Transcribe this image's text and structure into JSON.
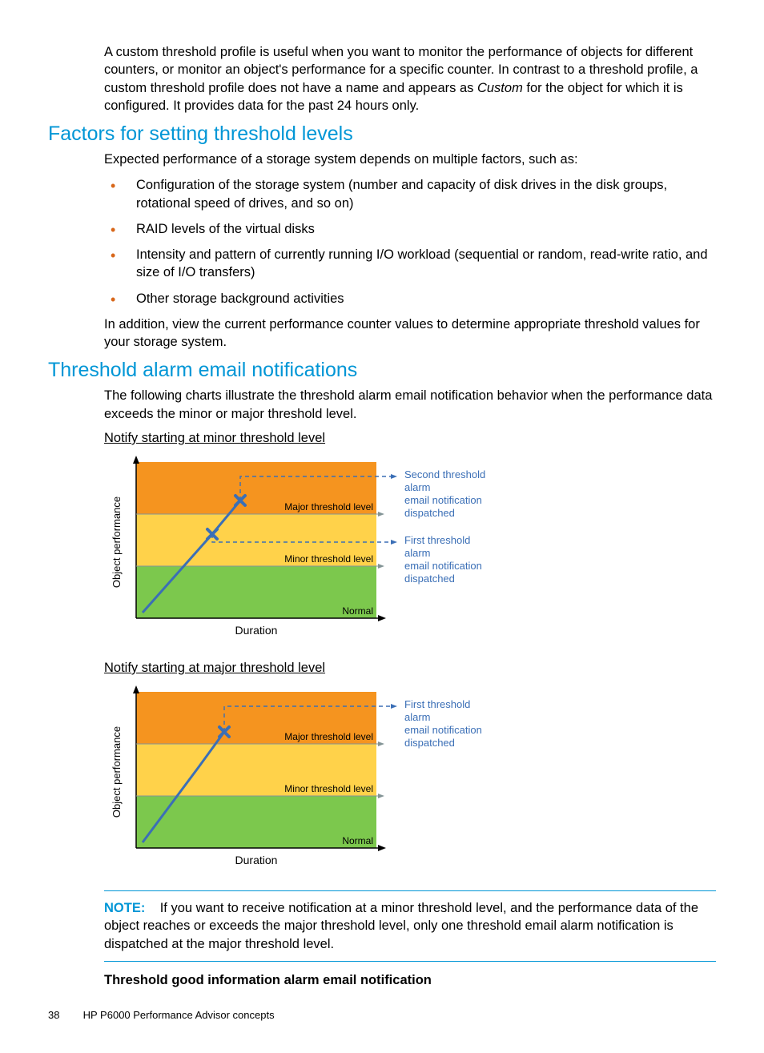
{
  "intro_paragraph": "A custom threshold profile is useful when you want to monitor the performance of objects for different counters, or monitor an object's performance for a specific counter. In contrast to a threshold profile, a custom threshold profile does not have a name and appears as ",
  "intro_italic": "Custom",
  "intro_tail": " for the object for which it is configured. It provides data for the past 24 hours only.",
  "section1_title": "Factors for setting threshold levels",
  "section1_intro": "Expected performance of a storage system depends on multiple factors, such as:",
  "bullets": [
    "Configuration of the storage system (number and capacity of disk drives in the disk groups, rotational speed of drives, and so on)",
    "RAID levels of the virtual disks",
    "Intensity and pattern of currently running I/O workload (sequential or random, read-write ratio, and size of I/O transfers)",
    "Other storage background activities"
  ],
  "section1_outro": "In addition, view the current performance counter values to determine appropriate threshold values for your storage system.",
  "section2_title": "Threshold alarm email notifications",
  "section2_intro": "The following charts illustrate the threshold alarm email notification behavior when the performance data exceeds the minor or major threshold level.",
  "chart1_caption": "Notify starting at minor threshold level",
  "chart2_caption": "Notify starting at major threshold level",
  "note_label": "NOTE:",
  "note_text": " If you want to receive notification at a minor threshold level, and the performance data of the object reaches or exceeds the major threshold level, only one threshold email alarm notification is dispatched at the major threshold level.",
  "bold_heading": "Threshold good information alarm email notification",
  "page_number": "38",
  "footer_text": "HP P6000 Performance Advisor concepts",
  "chart_data": [
    {
      "type": "area",
      "title": "Notify starting at minor threshold level",
      "xlabel": "Duration",
      "ylabel": "Object performance",
      "bands": [
        "Normal",
        "Minor threshold level",
        "Major threshold level"
      ],
      "band_colors": [
        "#7cc84d",
        "#ffd24a",
        "#f5941f"
      ],
      "line_points_approx_pct": [
        [
          3,
          95
        ],
        [
          33,
          46
        ],
        [
          45,
          26
        ]
      ],
      "events": [
        {
          "band": "Minor threshold level",
          "label": "First threshold alarm email notification dispatched"
        },
        {
          "band": "Major threshold level",
          "label": "Second threshold alarm email notification dispatched"
        }
      ]
    },
    {
      "type": "area",
      "title": "Notify starting at major threshold level",
      "xlabel": "Duration",
      "ylabel": "Object performance",
      "bands": [
        "Normal",
        "Minor threshold level",
        "Major threshold level"
      ],
      "band_colors": [
        "#7cc84d",
        "#ffd24a",
        "#f5941f"
      ],
      "line_points_approx_pct": [
        [
          3,
          95
        ],
        [
          27,
          48
        ],
        [
          38,
          26
        ]
      ],
      "events": [
        {
          "band": "Major threshold level",
          "label": "First threshold alarm email notification dispatched"
        }
      ]
    }
  ],
  "chart1": {
    "ylabel": "Object performance",
    "xlabel": "Duration",
    "band_normal": "Normal",
    "band_minor": "Minor threshold level",
    "band_major": "Major threshold level",
    "annot_top_l1": "Second threshold",
    "annot_top_l2": "alarm",
    "annot_top_l3": "email notification",
    "annot_top_l4": "dispatched",
    "annot_mid_l1": "First threshold",
    "annot_mid_l2": "alarm",
    "annot_mid_l3": "email notification",
    "annot_mid_l4": "dispatched"
  },
  "chart2": {
    "ylabel": "Object performance",
    "xlabel": "Duration",
    "band_normal": "Normal",
    "band_minor": "Minor threshold level",
    "band_major": "Major threshold level",
    "annot_top_l1": "First threshold",
    "annot_top_l2": "alarm",
    "annot_top_l3": "email notification",
    "annot_top_l4": "dispatched"
  }
}
